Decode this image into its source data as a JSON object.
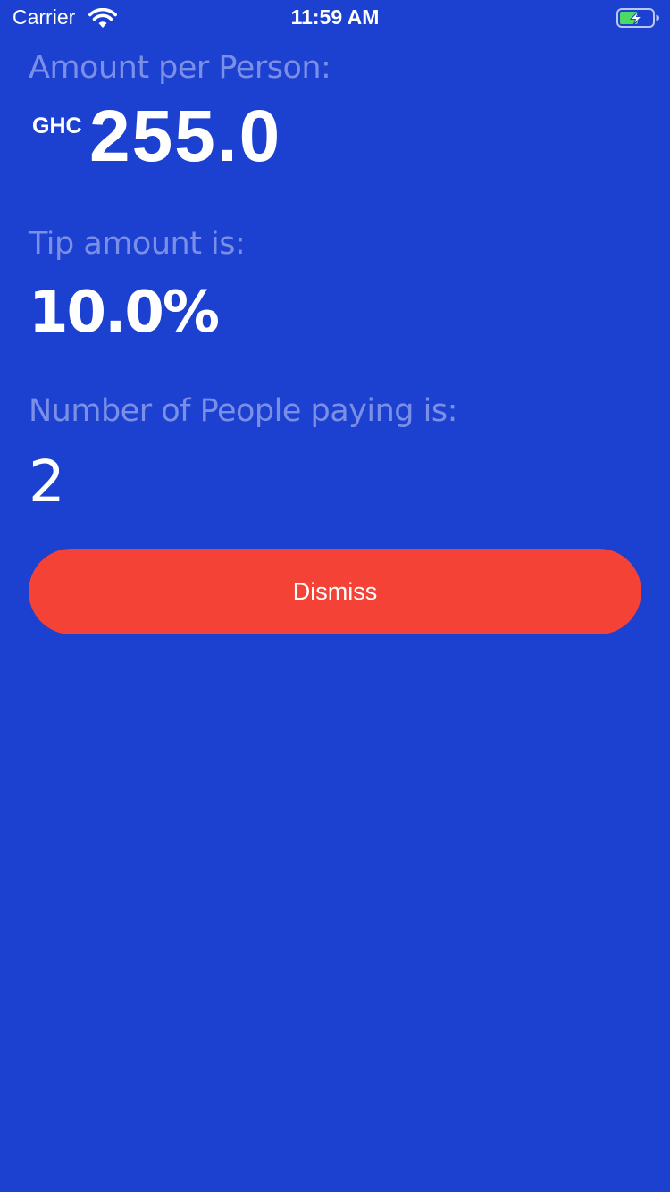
{
  "status_bar": {
    "carrier": "Carrier",
    "time": "11:59 AM"
  },
  "result": {
    "amount_label": "Amount per Person:",
    "currency": "GHC",
    "amount_value": "255.0",
    "tip_label": "Tip amount is:",
    "tip_value": "10.0%",
    "people_label": "Number of People paying is:",
    "people_value": "2"
  },
  "actions": {
    "dismiss_label": "Dismiss"
  },
  "colors": {
    "background": "#1c41d1",
    "label": "#7c8fe6",
    "button": "#f44336",
    "battery_charge": "#4cd964"
  },
  "icons": [
    "wifi-icon",
    "battery-charging-icon"
  ]
}
